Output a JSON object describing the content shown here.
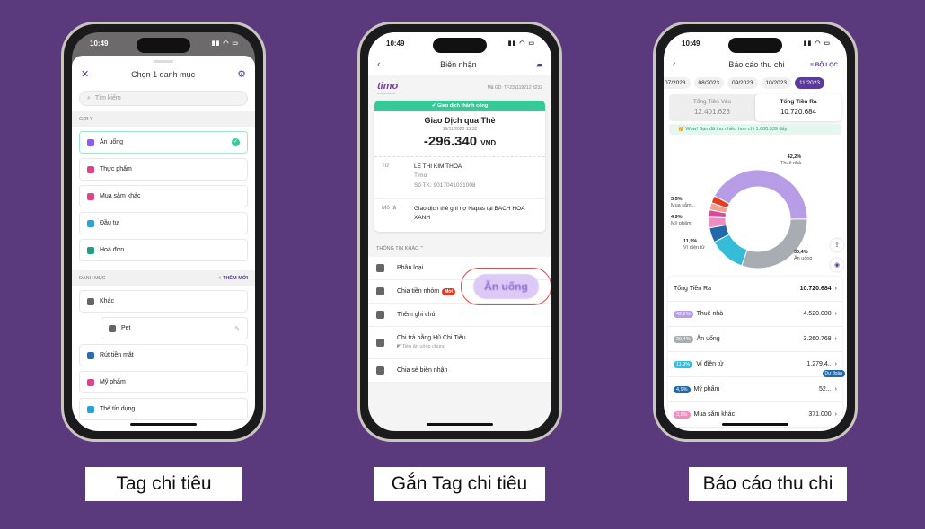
{
  "status_time": "10:49",
  "phone1": {
    "title": "Chọn 1 danh mục",
    "search_placeholder": "Tìm kiếm",
    "section_suggest": "GỢI Ý",
    "suggest": [
      {
        "label": "Ăn uống",
        "color": "#8b5cf6"
      },
      {
        "label": "Thực phẩm",
        "color": "#e0458b"
      },
      {
        "label": "Mua sắm khác",
        "color": "#e0458b"
      },
      {
        "label": "Đầu tư",
        "color": "#2aa3d6"
      },
      {
        "label": "Hoá đơn",
        "color": "#1f9e86"
      }
    ],
    "section_categories": "DANH MỤC",
    "add_new": "+ THÊM MỚI",
    "categories": [
      {
        "label": "Khác",
        "color": "#666"
      },
      {
        "label": "Pet",
        "color": "#666",
        "sub": true
      },
      {
        "label": "Rút tiền mặt",
        "color": "#2b6cb0"
      },
      {
        "label": "Mỹ phẩm",
        "color": "#e0458b"
      },
      {
        "label": "Thẻ tín dụng",
        "color": "#2aa3d6"
      }
    ]
  },
  "phone2": {
    "title": "Biên nhận",
    "brand": "timo",
    "brand_sub": "DIGITAL BANK",
    "txn_id": "Mã GD: TF231119212 3232",
    "success": "Giao dịch thành công",
    "txn_title": "Giao Dịch qua Thẻ",
    "datetime": "19/11/2023 13:32",
    "amount": "-296.340",
    "currency": "VND",
    "from_label": "Từ",
    "from_name": "LE THI KIM THOA",
    "from_bank": "Timo",
    "from_account": "Số TK: 9017041031008",
    "desc_label": "Mô tả",
    "desc": "Giao dịch thẻ ghi nợ Napas tại BACH HOA XANH",
    "other_info": "THÔNG TIN KHÁC",
    "highlight": "Ăn uống",
    "items": [
      {
        "label": "Phân loại"
      },
      {
        "label": "Chia tiền nhóm",
        "badge": "Mới"
      },
      {
        "label": "Thêm ghi chú"
      },
      {
        "label": "Chi trả bằng Hũ Chi Tiêu",
        "sub": "Tiền ăn uống chung"
      },
      {
        "label": "Chia sẻ biên nhận"
      }
    ]
  },
  "phone3": {
    "title": "Báo cáo thu chi",
    "filter": "BỘ LỌC",
    "months": [
      "07/2023",
      "08/2023",
      "09/2023",
      "10/2023",
      "11/2023"
    ],
    "active_month": "11/2023",
    "income_label": "Tổng Tiền Vào",
    "income": "12.401.623",
    "expense_label": "Tổng Tiền Ra",
    "expense": "10.720.684",
    "wow": "Wow! Bạn đã thu nhiều hơn chi 1.680.939 đấy!",
    "total_label": "Tổng Tiền Ra",
    "total": "10.720.684",
    "rows": [
      {
        "pct": "42,2%",
        "label": "Thuê nhà",
        "amount": "4.520.000",
        "color": "#b79de6"
      },
      {
        "pct": "30,4%",
        "label": "Ăn uống",
        "amount": "3.260.768",
        "color": "#a8acb3"
      },
      {
        "pct": "11,9%",
        "label": "Ví điện tử",
        "amount": "1.279.4..",
        "color": "#35bcd8"
      },
      {
        "pct": "4,9%",
        "label": "Mỹ phẩm",
        "amount": "52...",
        "color": "#2169a8"
      },
      {
        "pct": "3,5%",
        "label": "Mua sắm khác",
        "amount": "371.000",
        "color": "#f08cbf"
      }
    ],
    "forecast": "Dự đoán"
  },
  "chart_data": {
    "type": "pie",
    "slices": [
      {
        "label": "Thuê nhà",
        "value": 42.2,
        "color": "#b79de6"
      },
      {
        "label": "Ăn uống",
        "value": 30.4,
        "color": "#a8acb3"
      },
      {
        "label": "Ví điện tử",
        "value": 11.9,
        "color": "#35bcd8"
      },
      {
        "label": "Mỹ phẩm",
        "value": 4.9,
        "color": "#2169a8"
      },
      {
        "label": "Mua sắm...",
        "value": 3.5,
        "color": "#f08cbf"
      }
    ],
    "other_colors": [
      "#d94a9a",
      "#f5a08a",
      "#e53d1f"
    ]
  },
  "captions": [
    "Tag chi tiêu",
    "Gắn Tag chi tiêu",
    "Báo cáo thu chi"
  ]
}
